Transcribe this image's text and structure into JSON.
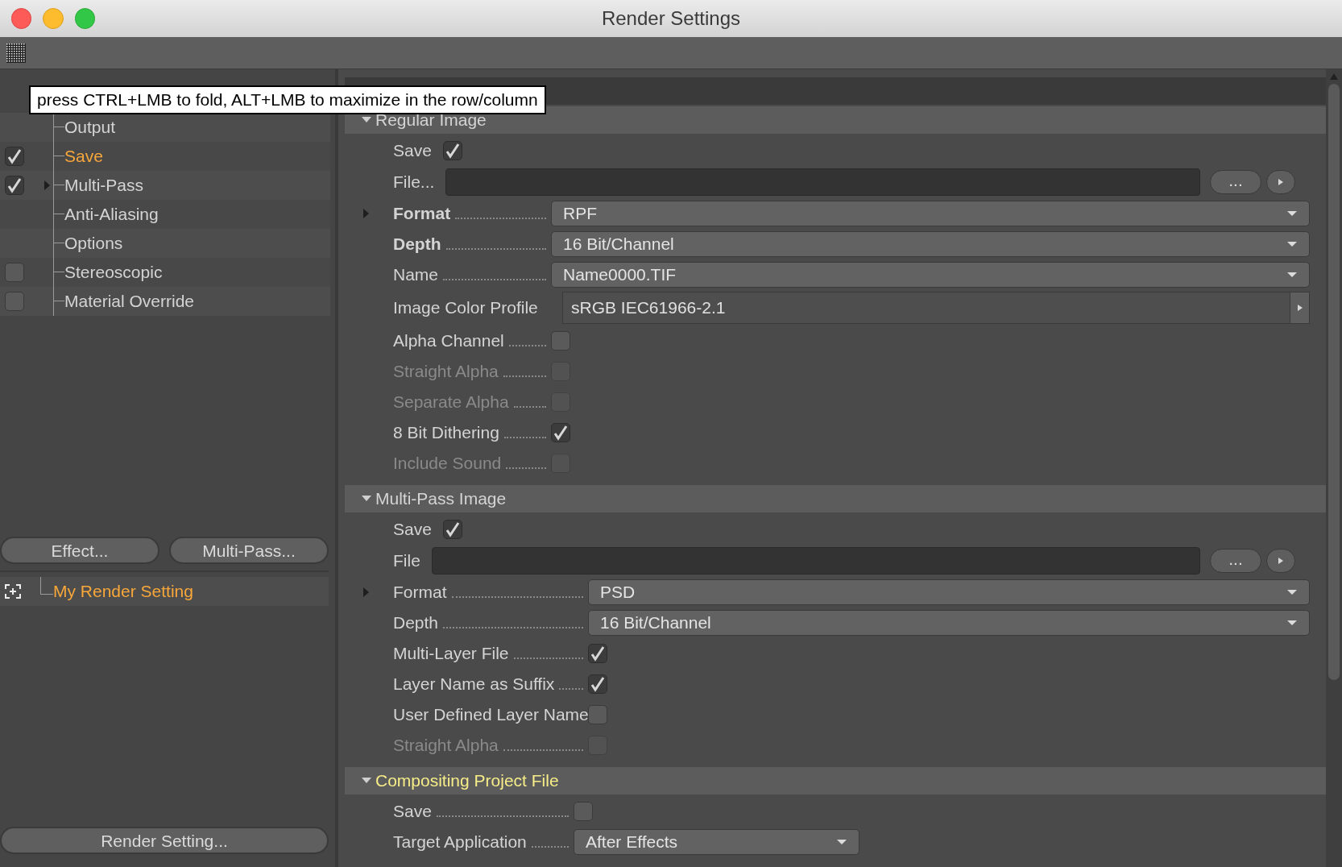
{
  "window": {
    "title": "Render Settings"
  },
  "tooltip": "press CTRL+LMB to fold, ALT+LMB to maximize in the row/column",
  "tree": [
    {
      "label": "Output",
      "kind": "plain",
      "selected": false
    },
    {
      "label": "Save",
      "kind": "checkbox",
      "checked": true,
      "selected": true
    },
    {
      "label": "Multi-Pass",
      "kind": "checkbox",
      "checked": true,
      "selected": false,
      "expanded": false
    },
    {
      "label": "Anti-Aliasing",
      "kind": "plain",
      "selected": false
    },
    {
      "label": "Options",
      "kind": "plain",
      "selected": false
    },
    {
      "label": "Stereoscopic",
      "kind": "checkbox",
      "checked": false,
      "selected": false
    },
    {
      "label": "Material Override",
      "kind": "checkbox",
      "checked": false,
      "selected": false
    }
  ],
  "left_buttons": [
    "Effect...",
    "Multi-Pass..."
  ],
  "settings_list": [
    {
      "label": "My Render Setting",
      "selected": true
    }
  ],
  "bottom_button": "Render Setting...",
  "sections": [
    {
      "title": "Regular Image",
      "expanded": true,
      "highlighted": false,
      "rows": [
        {
          "kind": "checkbox",
          "label": "Save",
          "checked": true,
          "disabled": false,
          "leader": false
        },
        {
          "kind": "file",
          "label": "File...",
          "button": "..."
        },
        {
          "kind": "dropdown",
          "label": "Format",
          "value": "RPF",
          "bold": true,
          "expander": true
        },
        {
          "kind": "dropdown",
          "label": "Depth",
          "value": "16 Bit/Channel",
          "bold": true,
          "expander": false
        },
        {
          "kind": "dropdown",
          "label": "Name",
          "value": "Name0000.TIF",
          "bold": false,
          "expander": false
        },
        {
          "kind": "profile",
          "label": "Image Color Profile",
          "value": "sRGB IEC61966-2.1"
        },
        {
          "kind": "checkbox",
          "label": "Alpha Channel",
          "checked": false,
          "disabled": false,
          "leader": true
        },
        {
          "kind": "checkbox",
          "label": "Straight Alpha",
          "checked": false,
          "disabled": true,
          "leader": true
        },
        {
          "kind": "checkbox",
          "label": "Separate Alpha",
          "checked": false,
          "disabled": true,
          "leader": true
        },
        {
          "kind": "checkbox",
          "label": "8 Bit Dithering",
          "checked": true,
          "disabled": false,
          "leader": true
        },
        {
          "kind": "checkbox",
          "label": "Include Sound",
          "checked": false,
          "disabled": true,
          "leader": true
        }
      ]
    },
    {
      "title": "Multi-Pass Image",
      "expanded": true,
      "highlighted": false,
      "rows": [
        {
          "kind": "checkbox",
          "label": "Save",
          "checked": true,
          "disabled": false,
          "leader": false
        },
        {
          "kind": "file",
          "label": "File",
          "button": "..."
        },
        {
          "kind": "dropdown",
          "label": "Format",
          "value": "PSD",
          "bold": false,
          "expander": true
        },
        {
          "kind": "dropdown",
          "label": "Depth",
          "value": "16 Bit/Channel",
          "bold": false,
          "expander": false
        },
        {
          "kind": "checkbox",
          "label": "Multi-Layer File",
          "checked": true,
          "disabled": false,
          "leader": true
        },
        {
          "kind": "checkbox",
          "label": "Layer Name as Suffix",
          "checked": true,
          "disabled": false,
          "leader": true
        },
        {
          "kind": "checkbox",
          "label": "User Defined Layer Name",
          "checked": false,
          "disabled": false,
          "leader": true
        },
        {
          "kind": "checkbox",
          "label": "Straight Alpha",
          "checked": false,
          "disabled": true,
          "leader": true
        }
      ]
    },
    {
      "title": "Compositing Project File",
      "expanded": true,
      "highlighted": true,
      "rows": [
        {
          "kind": "checkbox",
          "label": "Save",
          "checked": false,
          "disabled": false,
          "leader": true
        },
        {
          "kind": "shortdropdown",
          "label": "Target Application",
          "value": "After Effects",
          "bold": false,
          "expander": false
        }
      ]
    }
  ]
}
